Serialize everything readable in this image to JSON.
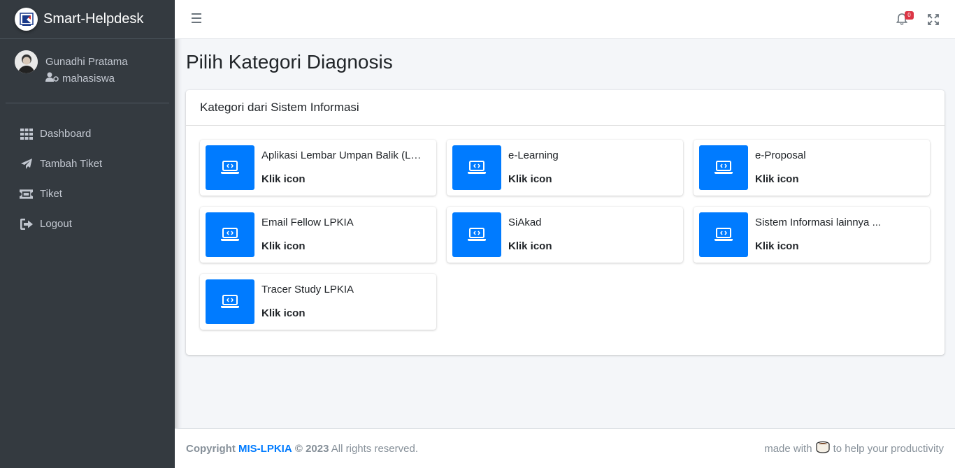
{
  "sidebar": {
    "brand": "Smart-Helpdesk",
    "user_name": "Gunadhi Pratama",
    "user_role": "mahasiswa",
    "items": [
      {
        "label": "Dashboard",
        "icon": "grid-icon"
      },
      {
        "label": "Tambah Tiket",
        "icon": "paper-plane-icon"
      },
      {
        "label": "Tiket",
        "icon": "ticket-icon"
      },
      {
        "label": "Logout",
        "icon": "sign-out-icon"
      }
    ]
  },
  "navbar": {
    "notification_count": "0"
  },
  "main": {
    "title": "Pilih Kategori Diagnosis",
    "card_header": "Kategori dari Sistem Informasi",
    "categories": [
      {
        "name": "Aplikasi Lembar Umpan Balik (LUB)",
        "action": "Klik icon"
      },
      {
        "name": "e-Learning",
        "action": "Klik icon"
      },
      {
        "name": "e-Proposal",
        "action": "Klik icon"
      },
      {
        "name": "Email Fellow LPKIA",
        "action": "Klik icon"
      },
      {
        "name": "SiAkad",
        "action": "Klik icon"
      },
      {
        "name": "Sistem Informasi lainnya ...",
        "action": "Klik icon"
      },
      {
        "name": "Tracer Study LPKIA",
        "action": "Klik icon"
      }
    ]
  },
  "footer": {
    "copyright_prefix": "Copyright",
    "brand": "MIS-LPKIA",
    "year": "© 2023",
    "rights": "All rights reserved.",
    "made_with": "made with",
    "tagline": "to help your productivity"
  },
  "colors": {
    "sidebar_bg": "#343a40",
    "primary": "#007bff",
    "badge": "#dc3545"
  }
}
